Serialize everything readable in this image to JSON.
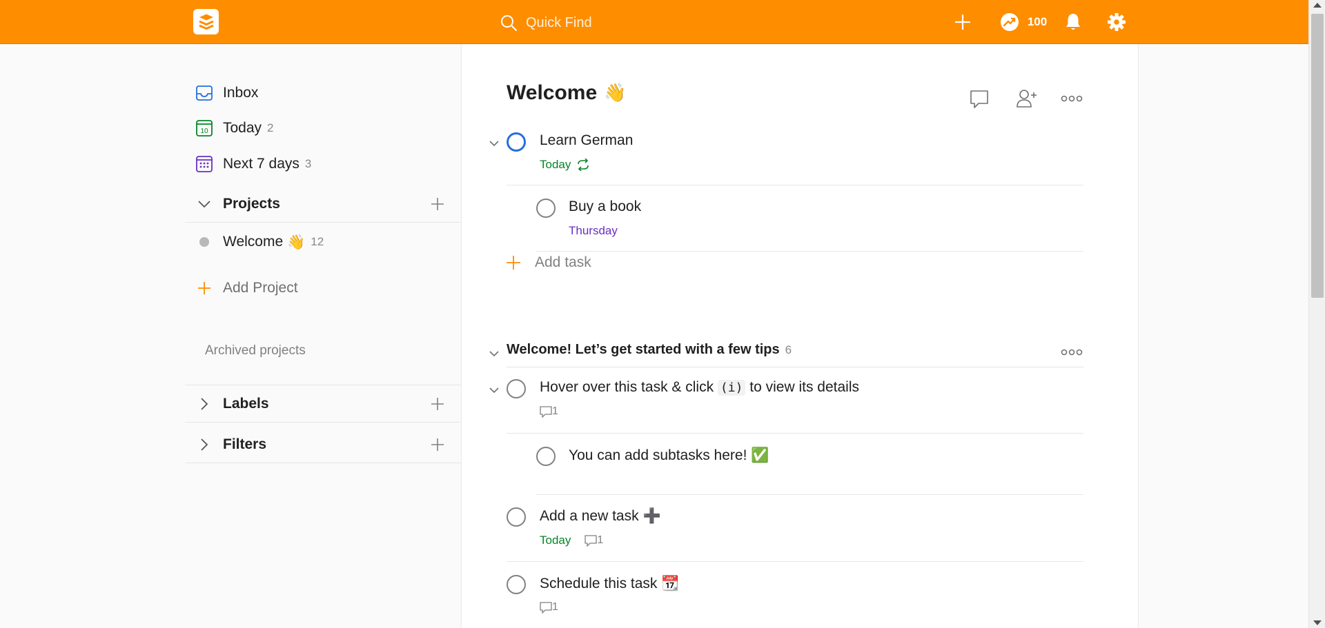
{
  "topbar": {
    "search_placeholder": "Quick Find",
    "karma": "100",
    "icons": [
      "todoist-logo-icon",
      "search-icon",
      "plus-icon",
      "karma-trend-icon",
      "bell-icon",
      "gear-icon"
    ]
  },
  "sidebar": {
    "nav": [
      {
        "label": "Inbox",
        "count": "",
        "icon": "inbox-icon"
      },
      {
        "label": "Today",
        "count": "2",
        "icon": "calendar-today-icon"
      },
      {
        "label": "Next 7 days",
        "count": "3",
        "icon": "calendar-week-icon"
      }
    ],
    "projects_header": "Projects",
    "projects": [
      {
        "label": "Welcome",
        "emoji": "👋",
        "count": "12"
      }
    ],
    "add_project": "Add Project",
    "archived": "Archived projects",
    "labels_header": "Labels",
    "filters_header": "Filters"
  },
  "main": {
    "title": "Welcome",
    "title_emoji": "👋",
    "tasks": [
      {
        "name": "Learn German",
        "date": "Today",
        "recurring": true
      },
      {
        "name": "Buy a book",
        "date": "Thursday"
      }
    ],
    "add_task": "Add task",
    "section": {
      "title": "Welcome! Let’s get started with a few tips",
      "count": "6",
      "tasks": [
        {
          "name_pre": "Hover over this task & click ",
          "name_code": "(i)",
          "name_post": " to view its details",
          "comments": "1"
        },
        {
          "name": "You can add subtasks here!",
          "emoji": "✅"
        },
        {
          "name": "Add a new task",
          "emoji": "➕",
          "date": "Today",
          "comments": "1"
        },
        {
          "name": "Schedule this task",
          "emoji": "📆",
          "comments": "1"
        }
      ]
    }
  },
  "colors": {
    "topbar": "#ff8d00",
    "today_green": "#058527",
    "thursday_purple": "#692fc2",
    "priority_blue": "#246fe0",
    "add_orange": "#ff8d00"
  }
}
